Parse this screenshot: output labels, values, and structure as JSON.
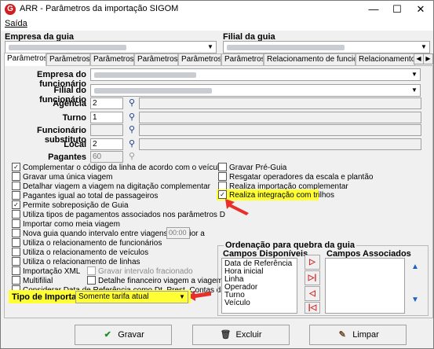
{
  "window": {
    "title": "ARR - Parâmetros da importação  SIGOM",
    "logo_letter": "G",
    "minimize": "—",
    "maximize": "☐",
    "close": "✕"
  },
  "menu": {
    "saida": "Saída"
  },
  "header": {
    "empresa_label": "Empresa  da guia",
    "filial_label": "Filial  da guia"
  },
  "tabs": [
    "Parâmetros A",
    "Parâmetros B",
    "Parâmetros C",
    "Parâmetros D",
    "Parâmetros E",
    "Parâmetros F",
    "Relacionamento de funcionários",
    "Relacionamento de v"
  ],
  "fields": {
    "empresa_funcionario": "Empresa do funcionário",
    "filial_funcionario": "Filial do funcionário",
    "agencia": {
      "label": "Agência",
      "value": "2"
    },
    "turno": {
      "label": "Turno",
      "value": "1"
    },
    "funcionario_substituto": {
      "label": "Funcionário substituto",
      "value": ""
    },
    "local": {
      "label": "Local",
      "value": "2"
    },
    "pagantes": {
      "label": "Pagantes",
      "value": "60"
    }
  },
  "checkboxes_left": [
    {
      "label": "Complementar o  código da linha de acordo com o veículo",
      "checked": true
    },
    {
      "label": "Gravar uma única viagem",
      "checked": false
    },
    {
      "label": "Detalhar viagem a viagem na digitação complementar",
      "checked": false
    },
    {
      "label": "Pagantes igual ao total de passageiros",
      "checked": false
    },
    {
      "label": "Permite sobreposição de Guia",
      "checked": true
    },
    {
      "label": "Utiliza tipos de pagamentos associados nos parâmetros D",
      "checked": false
    },
    {
      "label": "Importar como meia viagem",
      "checked": false
    },
    {
      "label": "Nova guia quando intervalo entre viagens superior a",
      "checked": false
    },
    {
      "label": "Utiliza o relacionamento de funcionários",
      "checked": false
    },
    {
      "label": "Utiliza o relacionamento de veículos",
      "checked": false
    },
    {
      "label": "Utiliza o relacionamento de linhas",
      "checked": false
    },
    {
      "label": "Importação XML",
      "checked": false
    },
    {
      "label": "Multifilial",
      "checked": false
    },
    {
      "label": "Considerar Data de Referência como Dt. Prest. Contas da guia",
      "checked": false
    }
  ],
  "intervalo_value": "00:00",
  "checkboxes_mid": [
    {
      "label": "Gravar intervalo fracionado",
      "checked": false
    },
    {
      "label": "Detalhe financeiro viagem a viagem",
      "checked": false
    }
  ],
  "checkboxes_right": [
    {
      "label": "Gravar Pré-Guia",
      "checked": false
    },
    {
      "label": "Resgatar operadores da escala e plantão",
      "checked": false
    },
    {
      "label": "Realiza importação complementar",
      "checked": false
    },
    {
      "label": "Realiza integração com trilhos",
      "checked": true
    }
  ],
  "ordenacao": {
    "title": "Ordenação para quebra da guia",
    "disponiveis_label": "Campos Disponíveis",
    "associados_label": "Campos Associados",
    "disponiveis": [
      "Data de Referência",
      "Hora inicial",
      "Linha",
      "Operador",
      "Turno",
      "Veículo"
    ],
    "associados": []
  },
  "tipo_importacao": {
    "label": "Tipo de Importação",
    "value": "Somente tarifa atual"
  },
  "buttons": {
    "gravar": "Gravar",
    "excluir": "Excluir",
    "limpar": "Limpar"
  },
  "colors": {
    "highlight": "#ffff33",
    "arrow": "#e8302a",
    "accent_blue": "#1f5fc4"
  }
}
